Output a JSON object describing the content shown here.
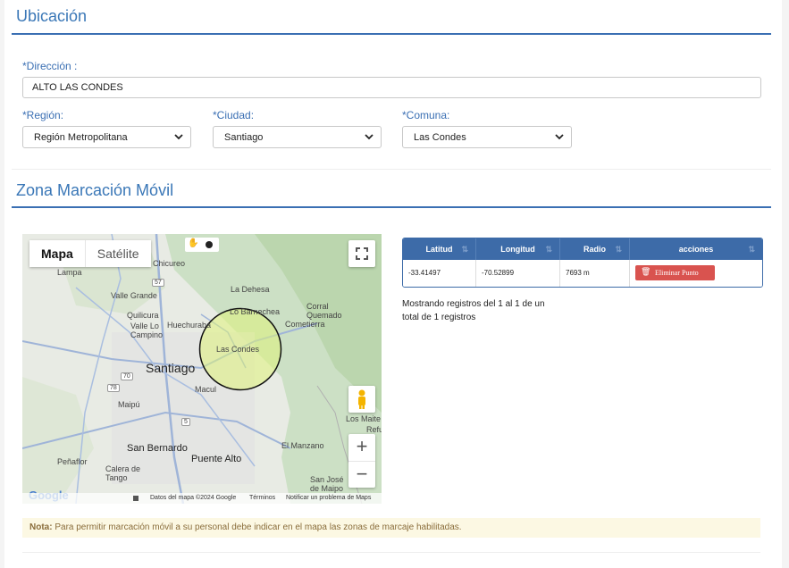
{
  "ubicacion": {
    "title": "Ubicación",
    "direccion": {
      "label": "*Dirección :",
      "value": "ALTO LAS CONDES"
    },
    "region": {
      "label": "*Región:",
      "value": "Región Metropolitana"
    },
    "ciudad": {
      "label": "*Ciudad:",
      "value": "Santiago"
    },
    "comuna": {
      "label": "*Comuna:",
      "value": "Las Condes"
    }
  },
  "zona": {
    "title": "Zona Marcación Móvil",
    "map": {
      "tab_map": "Mapa",
      "tab_satellite": "Satélite",
      "zoom_in": "+",
      "zoom_out": "−",
      "logo": "Google",
      "attribution": [
        "Datos del mapa ©2024 Google",
        "Términos",
        "Notificar un problema de Maps"
      ],
      "places": {
        "chicureo": "Chicureo",
        "lampa": "Lampa",
        "valle_grande": "Valle Grande",
        "quilicura": "Quilicura",
        "huechuraba": "Huechuraba",
        "valle_lo_campino": "Valle Lo\nCampino",
        "santiago": "Santiago",
        "macul": "Macul",
        "maipu": "Maipú",
        "san_bernardo": "San Bernardo",
        "puente_alto": "Puente Alto",
        "penaflor": "Peñaflor",
        "calera_de_tango": "Calera de\nTango",
        "la_dehesa": "La Dehesa",
        "lo_barnechea": "Lo Barnechea",
        "corral_quemado": "Corral\nQuemado",
        "cometierra": "Cometierra",
        "las_condes": "Las Condes",
        "los_maitenes": "Los Maite",
        "refugio": "Refu",
        "el_manzano": "El Manzano",
        "san_jose_de_maipo": "San José\nde Maipo",
        "route_57": "57",
        "route_70": "70",
        "route_78": "78",
        "route_5": "5"
      },
      "circle": {
        "center_lat": -33.41497,
        "center_lng": -70.52899,
        "radius_m": 7693
      }
    },
    "table": {
      "headers": [
        "Latitud",
        "Longitud",
        "Radio",
        "acciones"
      ],
      "rows": [
        {
          "latitud": "-33.41497",
          "longitud": "-70.52899",
          "radio": "7693 m",
          "accion": "Eliminar Punto"
        }
      ],
      "info": "Mostrando registros del 1 al 1 de un total de 1 registros"
    },
    "note": {
      "bold": "Nota:",
      "text": " Para permitir marcación móvil a su personal debe indicar en el mapa las zonas de marcaje habilitadas."
    }
  }
}
